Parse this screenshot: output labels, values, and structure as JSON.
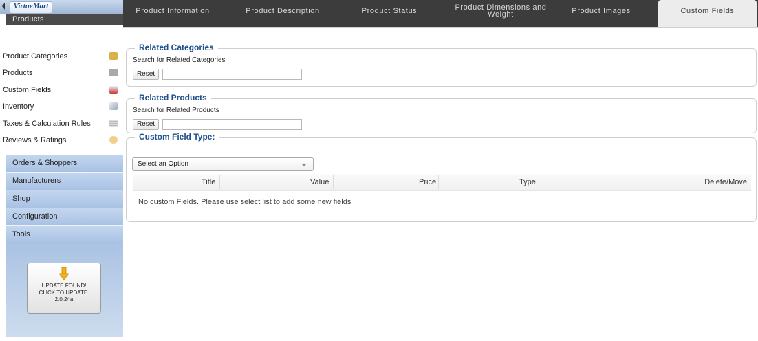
{
  "logo": {
    "brand": "VirtueMart"
  },
  "sidebar": {
    "current_section": "Products",
    "submenu": [
      {
        "label": "Product Categories",
        "icon": "categories-folder-icon",
        "color": "#d7b24a"
      },
      {
        "label": "Products",
        "icon": "camera-icon",
        "color": "#9a9a9a"
      },
      {
        "label": "Custom Fields",
        "icon": "custom-fields-icon",
        "color": "#c23b3b"
      },
      {
        "label": "Inventory",
        "icon": "inventory-chart-icon",
        "color": "#9aa7b5"
      },
      {
        "label": "Taxes & Calculation Rules",
        "icon": "calculator-icon",
        "color": "#b9b9b9"
      },
      {
        "label": "Reviews & Ratings",
        "icon": "speech-bubble-icon",
        "color": "#e9b04a"
      }
    ],
    "sections": [
      {
        "label": "Orders & Shoppers"
      },
      {
        "label": "Manufacturers"
      },
      {
        "label": "Shop"
      },
      {
        "label": "Configuration"
      },
      {
        "label": "Tools"
      }
    ],
    "update": {
      "line1": "UPDATE FOUND!",
      "line2": "CLICK TO UPDATE.",
      "version": "2.0.24a"
    }
  },
  "tabs": [
    {
      "label": "Product Information",
      "active": false
    },
    {
      "label": "Product Description",
      "active": false
    },
    {
      "label": "Product Status",
      "active": false
    },
    {
      "label": "Product Dimensions and Weight",
      "active": false
    },
    {
      "label": "Product Images",
      "active": false
    },
    {
      "label": "Custom Fields",
      "active": true
    }
  ],
  "related_categories": {
    "title": "Related Categories",
    "search_label": "Search for Related Categories",
    "reset_label": "Reset",
    "search_value": ""
  },
  "related_products": {
    "title": "Related Products",
    "search_label": "Search for Related Products",
    "reset_label": "Reset",
    "search_value": ""
  },
  "custom_field_type": {
    "title": "Custom Field Type:",
    "select_value": "Select an Option",
    "columns": [
      "Title",
      "Value",
      "Price",
      "Type",
      "Delete/Move"
    ],
    "empty_message": "No custom Fields. Please use select list to add some new fields"
  },
  "colors": {
    "tab_bar": "#3c3c3c",
    "legend_text": "#1f4f8c",
    "sidebar_accent": "#a9c2e3"
  }
}
